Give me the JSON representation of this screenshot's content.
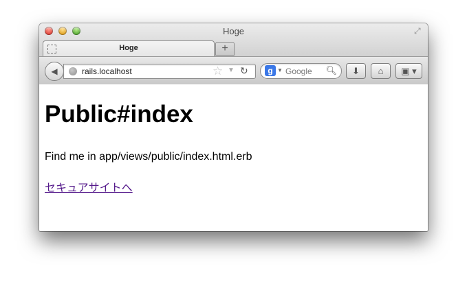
{
  "window": {
    "title": "Hoge"
  },
  "tabs": [
    {
      "label": "Hoge"
    }
  ],
  "toolbar": {
    "new_tab": "+",
    "url": "rails.localhost",
    "search_placeholder": "Google",
    "search_engine_glyph": "g"
  },
  "page": {
    "heading": "Public#index",
    "paragraph": "Find me in app/views/public/index.html.erb",
    "link": "セキュアサイトへ"
  },
  "colors": {
    "link_visited": "#551a8b"
  },
  "icons": [
    "close-icon",
    "minimize-icon",
    "zoom-icon",
    "fullscreen-icon",
    "tab-favicon-icon",
    "back-icon",
    "globe-icon",
    "star-icon",
    "reload-icon",
    "google-icon",
    "search-icon",
    "download-icon",
    "home-icon",
    "bookmarks-icon"
  ]
}
